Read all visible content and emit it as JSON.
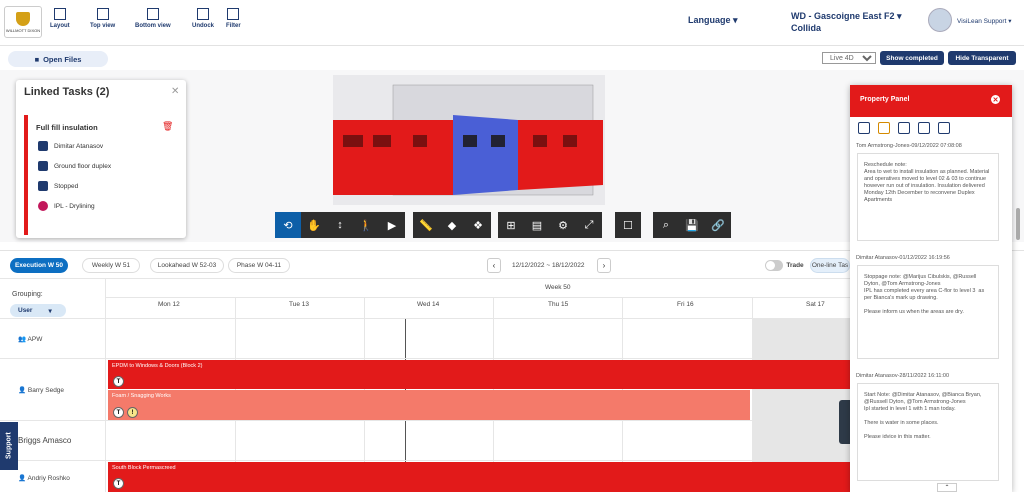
{
  "header": {
    "logo_text": "WILLMOTT DIXON",
    "tools": [
      {
        "label": "Layout"
      },
      {
        "label": "Top view"
      },
      {
        "label": "Bottom view"
      },
      {
        "label": "Undock"
      },
      {
        "label": "Filter"
      }
    ],
    "language": "Language",
    "project_line1": "WD - Gascoigne East F2",
    "project_line2": "Collida",
    "user": "VisiLean Support"
  },
  "open_files": "Open Files",
  "view_mode": "Live 4D",
  "show_completed": "Show completed",
  "hide_transparent": "Hide Transparent",
  "linked": {
    "title": "Linked Tasks (2)",
    "task": "Full fill insulation",
    "rows": [
      "Dimitar Atanasov",
      "Ground floor duplex",
      "Stopped",
      "IPL - Drylining"
    ]
  },
  "filters": {
    "execution": "Execution  W 50",
    "weekly": "Weekly  W 51",
    "lookahead": "Lookahead  W 52-03",
    "phase": "Phase  W 04-11",
    "date_range": "12/12/2022 ~ 18/12/2022",
    "trade": "Trade",
    "oneline": "One-line Tas"
  },
  "gantt": {
    "grouping": "Grouping:",
    "group_by": "User",
    "week": "Week 50",
    "days": [
      "Mon 12",
      "Tue 13",
      "Wed 14",
      "Thu 15",
      "Fri 16",
      "Sat 17"
    ],
    "people": [
      "APW",
      "Barry Sedge",
      "Briggs Amasco",
      "Andriy Roshko"
    ],
    "bars": [
      "EPDM to Windows & Doors (Block 2)",
      "Foam / Snagging Works",
      "South Block Permascreed"
    ]
  },
  "property": {
    "title": "Property Panel",
    "notes": [
      {
        "head": "Tom Armstrong-Jones-09/12/2022 07:08:08",
        "body": "Reschedule note:\nArea to wet to install insulation as planned. Material and operatives moved to level 02 & 03 to continue however run out of insulation. Insulation delivered Monday 12th December to reconvene Duplex Apartments"
      },
      {
        "head": "Dimitar Atanasov-01/12/2022 16:19:56",
        "body": "Stoppage note: @Marijus Cibulskis, @Russell Dyton, @Tom Armstrong-Jones\nIPL has completed every area C-flor to level 3  as per Bianca's mark up drawing.\n\nPlease inform us when the areas are dry."
      },
      {
        "head": "Dimitar Atanasov-28/11/2022 16:11:00",
        "body": "Start Note: @Dimitar Atanasov, @Bianca Bryan, @Russell Dyton, @Tom Armstrong-Jones\nIpl started in level 1 with 1 man today.\n\nThere is water in some places.\n\nPlease idvice in this matter."
      }
    ]
  },
  "support": "Support",
  "colors": {
    "red": "#e21a1a",
    "navy": "#1f3a6e",
    "salmon": "#f47a6a"
  }
}
